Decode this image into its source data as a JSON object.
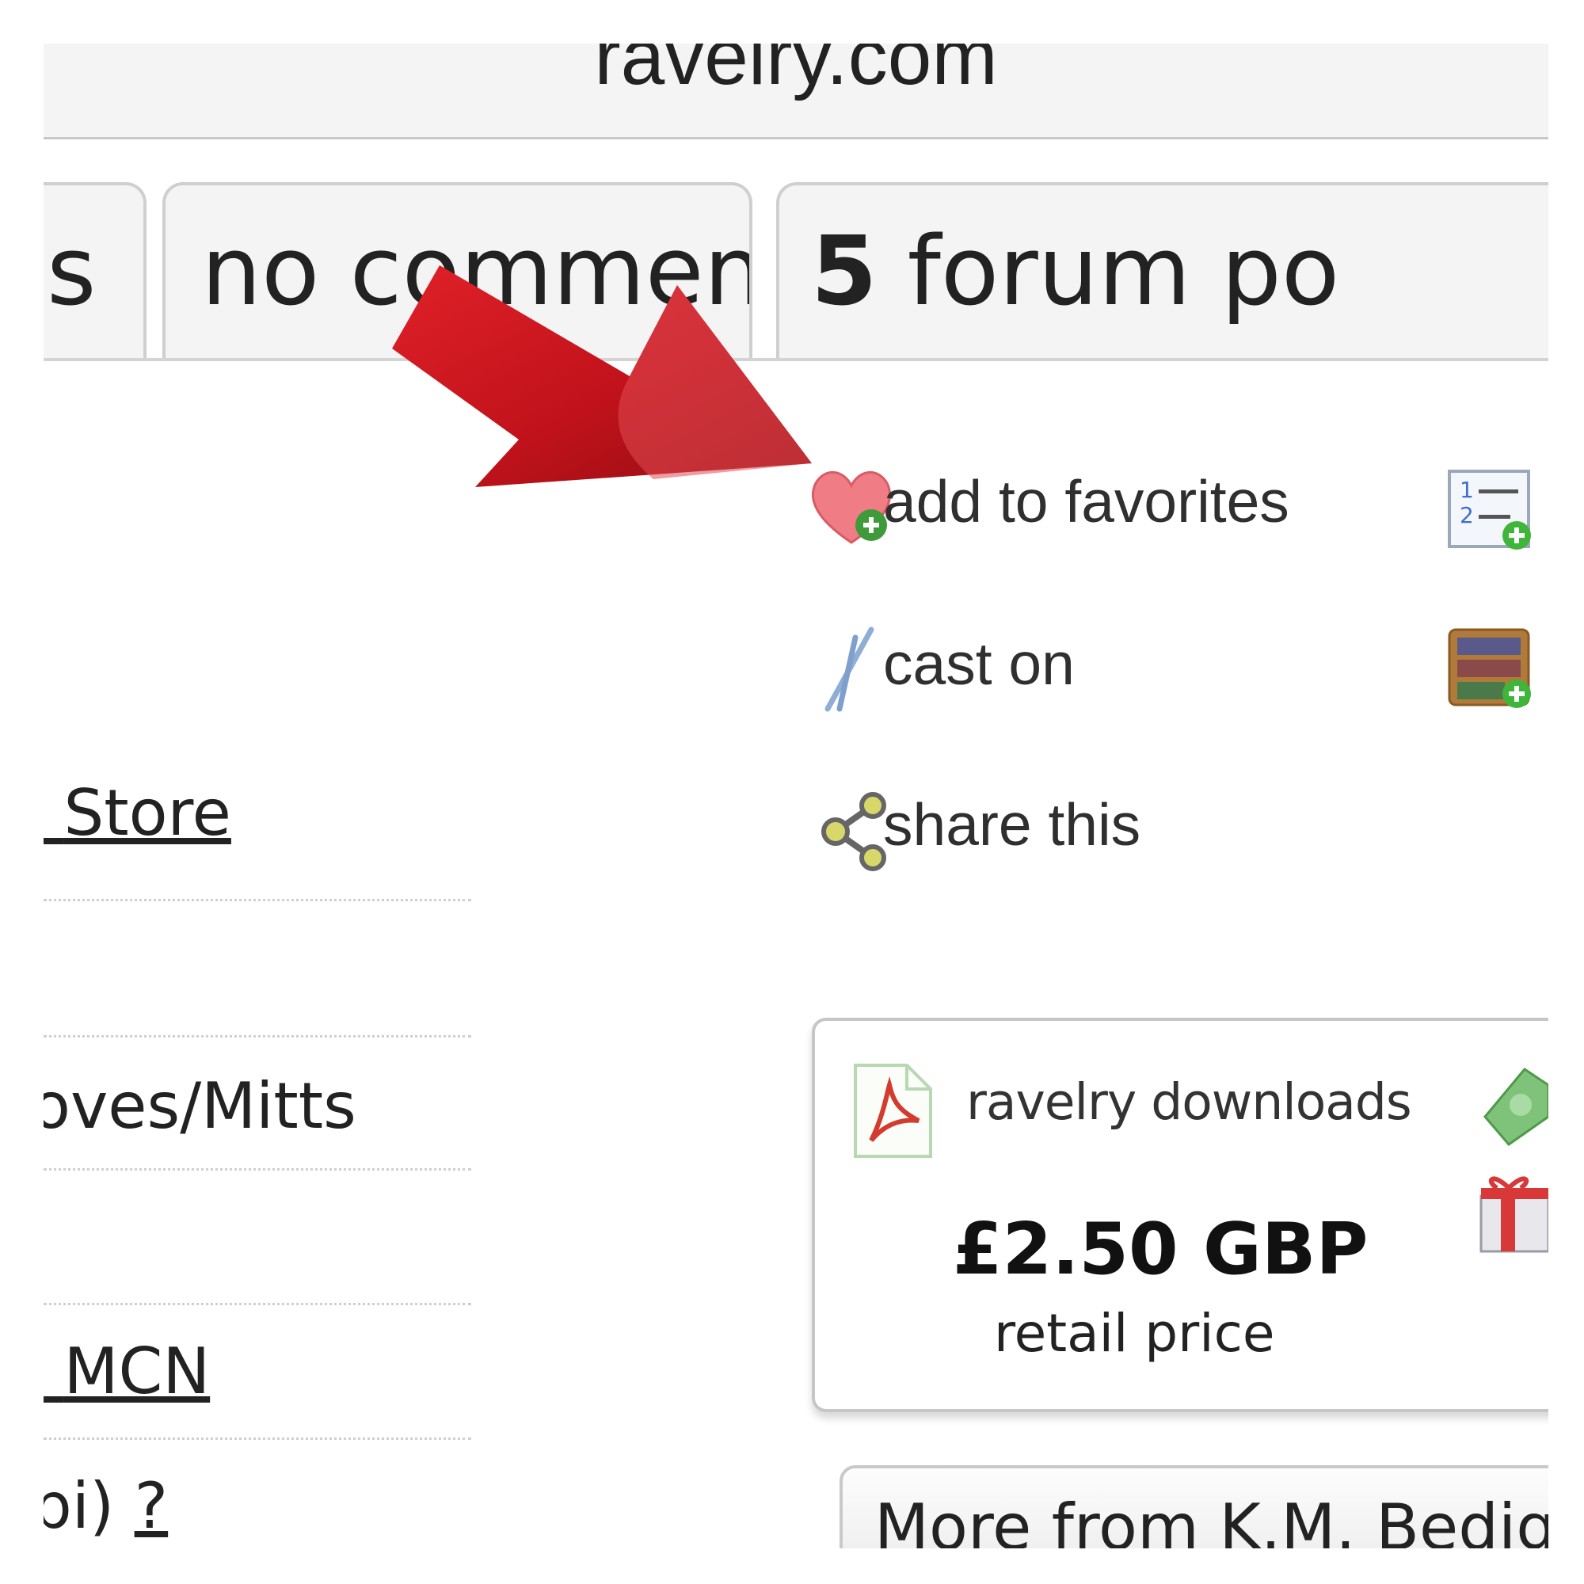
{
  "browser": {
    "url": "ravelry.com"
  },
  "tabs": {
    "partial_left": "s",
    "comments": "no comments",
    "forum_count": "5",
    "forum_label": "forum po"
  },
  "actions": {
    "favorites": "add to favorites",
    "cast_on": "cast on",
    "share": "share this"
  },
  "left_column": {
    "store_link": "Store",
    "category": "oves/Mitts",
    "mcn_link": "MCN",
    "gauge_tail": "pi)",
    "help_link": "?"
  },
  "purchase": {
    "source": "ravelry downloads",
    "price": "£2.50 GBP",
    "price_label": "retail price"
  },
  "more_button": "More from K.M. Bediga",
  "colors": {
    "arrow": "#c8151d",
    "tab_bg": "#f4f4f4",
    "border": "#cfcfcf"
  }
}
